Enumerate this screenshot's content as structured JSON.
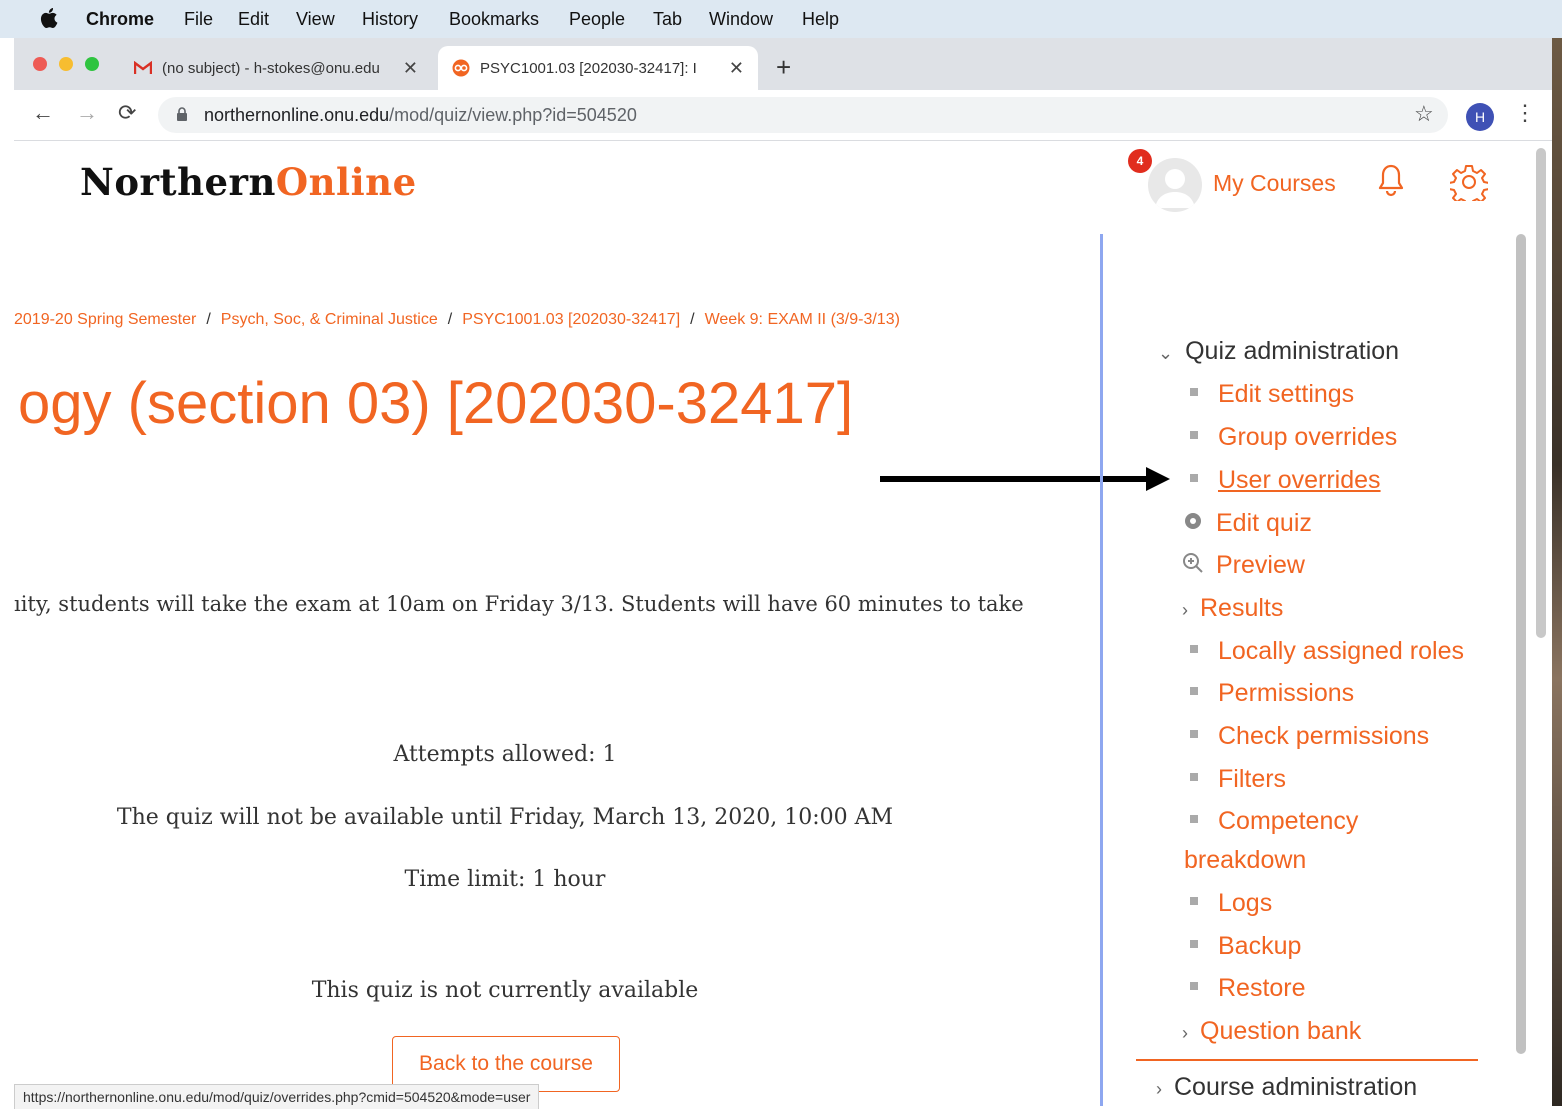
{
  "menubar": {
    "app": "Chrome",
    "items": [
      "File",
      "Edit",
      "View",
      "History",
      "Bookmarks",
      "People",
      "Tab",
      "Window",
      "Help"
    ]
  },
  "tabs": [
    {
      "title": "(no subject) - h-stokes@onu.edu",
      "favicon": "gmail-icon"
    },
    {
      "title": "PSYC1001.03 [202030-32417]: I",
      "favicon": "moodle-icon"
    }
  ],
  "address": {
    "domain": "northernonline.onu.edu",
    "path": "/mod/quiz/view.php?id=504520"
  },
  "profile_initial": "H",
  "logo": {
    "part1": "Northern",
    "part2": "Online"
  },
  "breadcrumb": [
    "2019-20 Spring Semester",
    "Psych, Soc, & Criminal Justice",
    "PSYC1001.03 [202030-32417]",
    "Week 9: EXAM II (3/9-3/13)"
  ],
  "page_title": "ogy (section 03) [202030-32417]",
  "intro": "ıity, students will take the exam at 10am on Friday 3/13. Students will have 60 minutes to take",
  "quiz_info": {
    "attempts": "Attempts allowed: 1",
    "availability": "The quiz will not be available until Friday, March 13, 2020, 10:00 AM",
    "time_limit": "Time limit: 1 hour",
    "status": "This quiz is not currently available"
  },
  "back_button": "Back to the course",
  "status_url": "https://northernonline.onu.edu/mod/quiz/overrides.php?cmid=504520&mode=user",
  "user_menu": {
    "notification_count": "4",
    "my_courses": "My Courses"
  },
  "drawer": {
    "quiz_admin_title": "Quiz administration",
    "items": {
      "edit_settings": "Edit settings",
      "group_overrides": "Group overrides",
      "user_overrides": "User overrides",
      "edit_quiz": "Edit quiz",
      "preview": "Preview",
      "results": "Results",
      "locally_assigned_roles": "Locally assigned roles",
      "permissions": "Permissions",
      "check_permissions": "Check permissions",
      "filters": "Filters",
      "competency_1": "Competency",
      "competency_2": "breakdown",
      "logs": "Logs",
      "backup": "Backup",
      "restore": "Restore",
      "question_bank": "Question bank"
    },
    "course_admin_title": "Course administration"
  },
  "colors": {
    "accent": "#f16522",
    "badge": "#e12d1e"
  }
}
